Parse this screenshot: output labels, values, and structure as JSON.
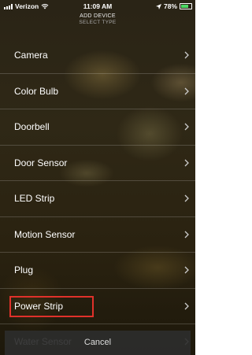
{
  "status_bar": {
    "carrier": "Verizon",
    "time": "11:09 AM",
    "battery": "78%",
    "battery_color": "#4cd964"
  },
  "header": {
    "title": "ADD DEVICE",
    "subtitle": "SELECT TYPE"
  },
  "device_types": [
    {
      "label": "Camera"
    },
    {
      "label": "Color Bulb"
    },
    {
      "label": "Doorbell"
    },
    {
      "label": "Door Sensor"
    },
    {
      "label": "LED Strip"
    },
    {
      "label": "Motion Sensor"
    },
    {
      "label": "Plug"
    },
    {
      "label": "Power Strip",
      "highlighted": true
    },
    {
      "label": "Water Sensor"
    }
  ],
  "icons": {
    "row_chevron": "chevron-right-icon",
    "signal": "signal-icon",
    "wifi": "wifi-icon",
    "location": "location-arrow-icon",
    "battery": "battery-icon"
  },
  "highlight_color": "#e0312a",
  "cancel_label": "Cancel"
}
